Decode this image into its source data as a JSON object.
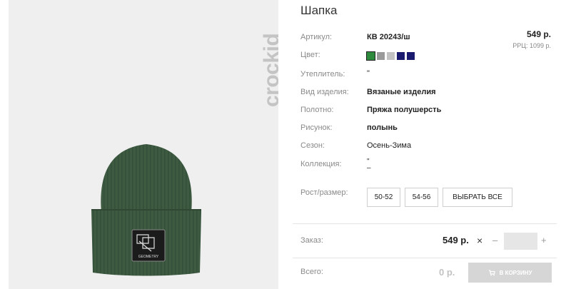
{
  "brand": {
    "logo_text": "crockid"
  },
  "product": {
    "title": "Шапка",
    "price": "549 р.",
    "rrp": "РРЦ: 1099 р."
  },
  "specs": [
    {
      "label": "Артикул:",
      "value": "КВ 20243/ш"
    },
    {
      "label": "Цвет:",
      "value": ""
    },
    {
      "label": "Утеплитель:",
      "value": "\""
    },
    {
      "label": "Вид изделия:",
      "value": "Вязаные изделия"
    },
    {
      "label": "Полотно:",
      "value": "Пряжа полушерсть"
    },
    {
      "label": "Рисунок:",
      "value": "полынь"
    },
    {
      "label": "Сезон:",
      "value": "Осень-Зима"
    },
    {
      "label": "Коллекция:",
      "value": "\"\n–"
    }
  ],
  "colors": {
    "swatches": [
      "#2e8b3e",
      "#9a9a9a",
      "#c3c3c3",
      "#1a1a6e",
      "#1a1a6e"
    ],
    "selected_index": 0
  },
  "size": {
    "label": "Рост/размер:",
    "options": [
      "50-52",
      "54-56"
    ],
    "select_all_label": "ВЫБРАТЬ ВСЕ"
  },
  "order": {
    "label": "Заказ:",
    "price": "549 р.",
    "times": "×",
    "minus": "–",
    "plus": "+",
    "qty": ""
  },
  "total": {
    "label": "Всего:",
    "value": "0 р.",
    "cart_label": "В КОРЗИНУ"
  },
  "image": {
    "patch_text": "GEOMETRY",
    "hat_color": "#3d5a40"
  }
}
